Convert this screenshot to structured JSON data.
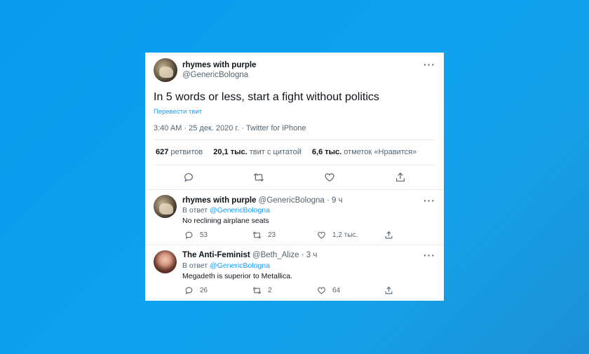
{
  "main_tweet": {
    "author_name": "rhymes with purple",
    "author_handle": "@GenericBologna",
    "text": "In 5 words or less, start a fight without politics",
    "translate_label": "Перевести твит",
    "meta": "3:40 AM · 25 дек. 2020 г. · Twitter for iPhone",
    "stats": {
      "retweets_count": "627",
      "retweets_label": "ретвитов",
      "quotes_count": "20,1 тыс.",
      "quotes_label": "твит с цитатой",
      "likes_count": "6,6 тыс.",
      "likes_label": "отметок «Нравится»"
    },
    "more_icon": "more-dots-icon",
    "actions": [
      "reply-icon",
      "retweet-icon",
      "like-icon",
      "share-icon"
    ]
  },
  "replies": [
    {
      "author_name": "rhymes with purple",
      "author_handle": "@GenericBologna",
      "time": "· 9 ч",
      "reply_to_prefix": "В ответ",
      "reply_to_handle": "@GenericBologna",
      "text": "No reclining airplane seats",
      "reply_count": "53",
      "retweet_count": "23",
      "like_count": "1,2 тыс."
    },
    {
      "author_name": "The Anti-Feminist",
      "author_handle": "@Beth_Alize",
      "time": "· 3 ч",
      "reply_to_prefix": "В ответ",
      "reply_to_handle": "@GenericBologna",
      "text": "Megadeth is superior to Metallica.",
      "reply_count": "26",
      "retweet_count": "2",
      "like_count": "64"
    }
  ],
  "colors": {
    "background": "#0ea2f0",
    "link": "#1d9bf0",
    "text": "#0f1419",
    "secondary": "#536471"
  }
}
